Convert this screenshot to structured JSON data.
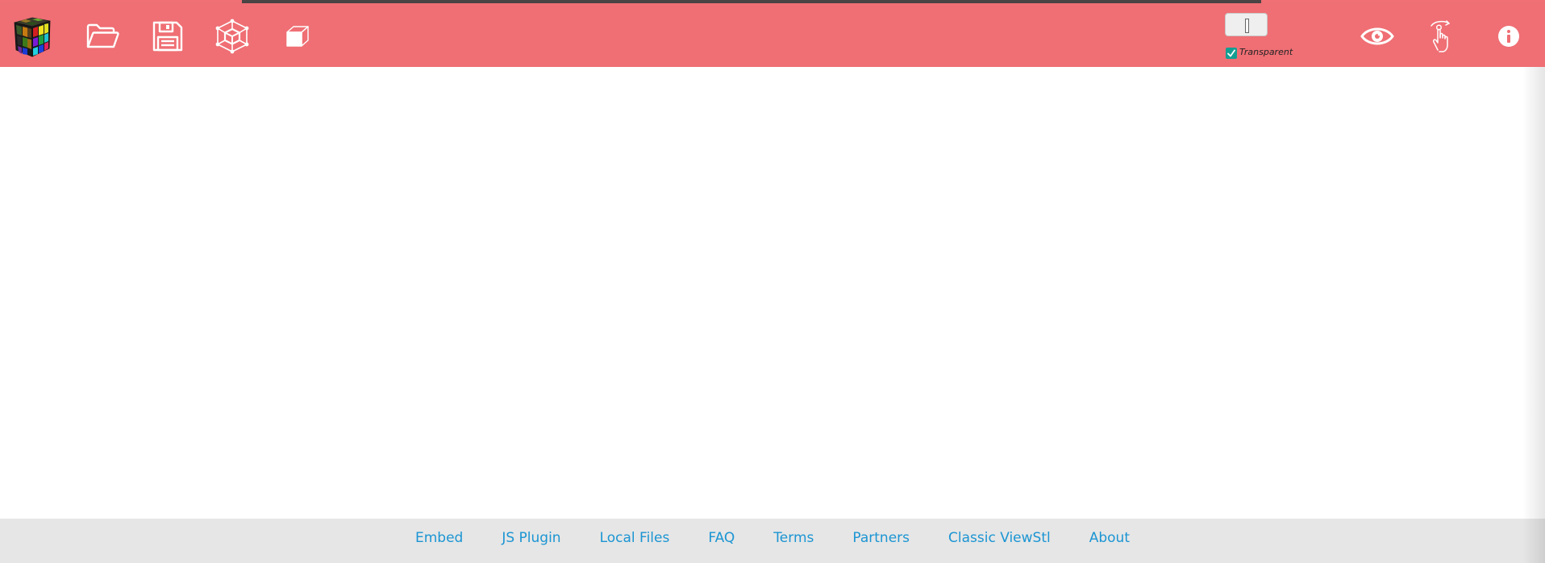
{
  "toolbar": {
    "background_color": "#ef6f74",
    "left_buttons": [
      {
        "name": "app-logo-cube",
        "icon": "rubiks-cube-icon"
      },
      {
        "name": "open-file-button",
        "icon": "folder-open-icon"
      },
      {
        "name": "save-button",
        "icon": "floppy-disk-icon"
      },
      {
        "name": "wireframe-button",
        "icon": "wireframe-cube-icon"
      },
      {
        "name": "solid-view-button",
        "icon": "solid-cube-icon"
      }
    ],
    "color_picker": {
      "value": "#efefef"
    },
    "transparent": {
      "label": "Transparent",
      "checked": true,
      "check_color": "#149e92"
    },
    "right_buttons": [
      {
        "name": "view-button",
        "icon": "eye-icon"
      },
      {
        "name": "gesture-button",
        "icon": "hand-rotate-icon"
      },
      {
        "name": "info-button",
        "icon": "info-icon"
      }
    ]
  },
  "footer": {
    "background_color": "#e6e6e6",
    "link_color": "#1b95d3",
    "links": [
      "Embed",
      "JS Plugin",
      "Local Files",
      "FAQ",
      "Terms",
      "Partners",
      "Classic ViewStl",
      "About"
    ]
  }
}
